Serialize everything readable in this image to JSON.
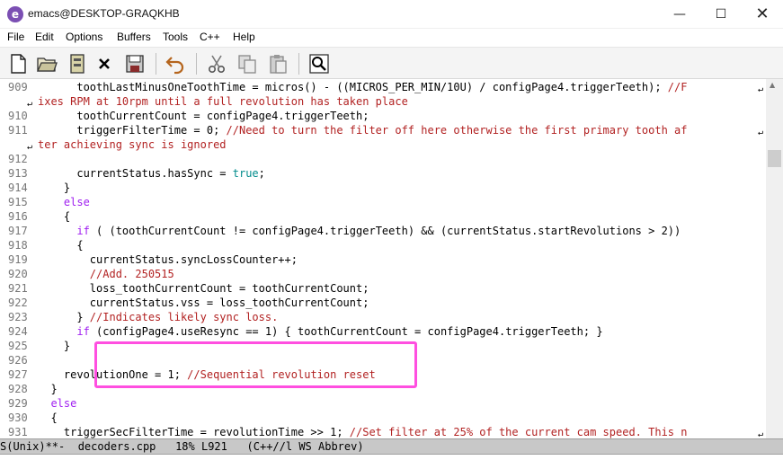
{
  "window": {
    "title": "emacs@DESKTOP-GRAQKHB",
    "min_glyph": "—",
    "max_glyph": "☐",
    "close_glyph": "✕",
    "icon_letter": "e"
  },
  "menu": [
    "File",
    "Edit",
    "Options",
    "Buffers",
    "Tools",
    "C++",
    "Help"
  ],
  "toolbar": [
    "new-file-icon",
    "open-folder-icon",
    "dired-icon",
    "close-icon",
    "save-icon",
    "undo-icon",
    "cut-icon",
    "copy-icon",
    "paste-icon",
    "search-icon"
  ],
  "lines": [
    {
      "n": "909",
      "code": "      toothLastMinusOneToothTime = micros() - ((MICROS_PER_MIN/10U) / configPage4.triggerTeeth); ",
      "comment": "//F",
      "wrap": true
    },
    {
      "n": "",
      "code": "",
      "comment": "ixes RPM at 10rpm until a full revolution has taken place",
      "wrap": false,
      "cont": true
    },
    {
      "n": "910",
      "code": "      toothCurrentCount = configPage4.triggerTeeth;",
      "comment": "",
      "wrap": false
    },
    {
      "n": "911",
      "code": "      triggerFilterTime = 0; ",
      "comment": "//Need to turn the filter off here otherwise the first primary tooth af",
      "wrap": true
    },
    {
      "n": "",
      "code": "",
      "comment": "ter achieving sync is ignored",
      "wrap": false,
      "cont": true
    },
    {
      "n": "912",
      "code": "",
      "comment": "",
      "wrap": false
    },
    {
      "n": "913",
      "code": "      currentStatus.hasSync = ",
      "const": "true",
      "tail": ";",
      "comment": "",
      "wrap": false
    },
    {
      "n": "914",
      "code": "    }",
      "comment": "",
      "wrap": false
    },
    {
      "n": "915",
      "code": "    ",
      "kw": "else",
      "comment": "",
      "wrap": false
    },
    {
      "n": "916",
      "code": "    {",
      "comment": "",
      "wrap": false
    },
    {
      "n": "917",
      "code": "      ",
      "kw": "if",
      "tail": " ( (toothCurrentCount != configPage4.triggerTeeth) && (currentStatus.startRevolutions > 2))",
      "comment": "",
      "wrap": false
    },
    {
      "n": "918",
      "code": "      {",
      "comment": "",
      "wrap": false
    },
    {
      "n": "919",
      "code": "        currentStatus.syncLossCounter++;",
      "comment": "",
      "wrap": false
    },
    {
      "n": "920",
      "code": "        ",
      "comment": "//Add. 250515",
      "wrap": false
    },
    {
      "n": "921",
      "code": "        loss_toothCurrentCount = toothCurrentCount;",
      "comment": "",
      "wrap": false
    },
    {
      "n": "922",
      "code": "        currentStatus.vss = loss_toothCurrentCount;",
      "comment": "",
      "wrap": false
    },
    {
      "n": "923",
      "code": "      } ",
      "comment": "//Indicates likely sync loss.",
      "wrap": false
    },
    {
      "n": "924",
      "code": "      ",
      "kw": "if",
      "tail": " (configPage4.useResync == 1) { toothCurrentCount = configPage4.triggerTeeth; }",
      "comment": "",
      "wrap": false
    },
    {
      "n": "925",
      "code": "    }",
      "comment": "",
      "wrap": false
    },
    {
      "n": "926",
      "code": "",
      "comment": "",
      "wrap": false
    },
    {
      "n": "927",
      "code": "    revolutionOne = 1; ",
      "comment": "//Sequential revolution reset",
      "wrap": false
    },
    {
      "n": "928",
      "code": "  }",
      "comment": "",
      "wrap": false
    },
    {
      "n": "929",
      "code": "  ",
      "kw": "else",
      "comment": "",
      "wrap": false
    },
    {
      "n": "930",
      "code": "  {",
      "comment": "",
      "wrap": false
    },
    {
      "n": "931",
      "code": "    triggerSecFilterTime = revolutionTime >> 1; ",
      "comment": "//Set filter at 25% of the current cam speed. This n",
      "wrap": true
    }
  ],
  "modeline": "S(Unix)**-  decoders.cpp   18% L921   (C++//l WS Abbrev)",
  "colors": {
    "comment": "#b22222",
    "keyword": "#a020f0",
    "constant": "#008b8b",
    "highlight": "#ff4fe0"
  }
}
